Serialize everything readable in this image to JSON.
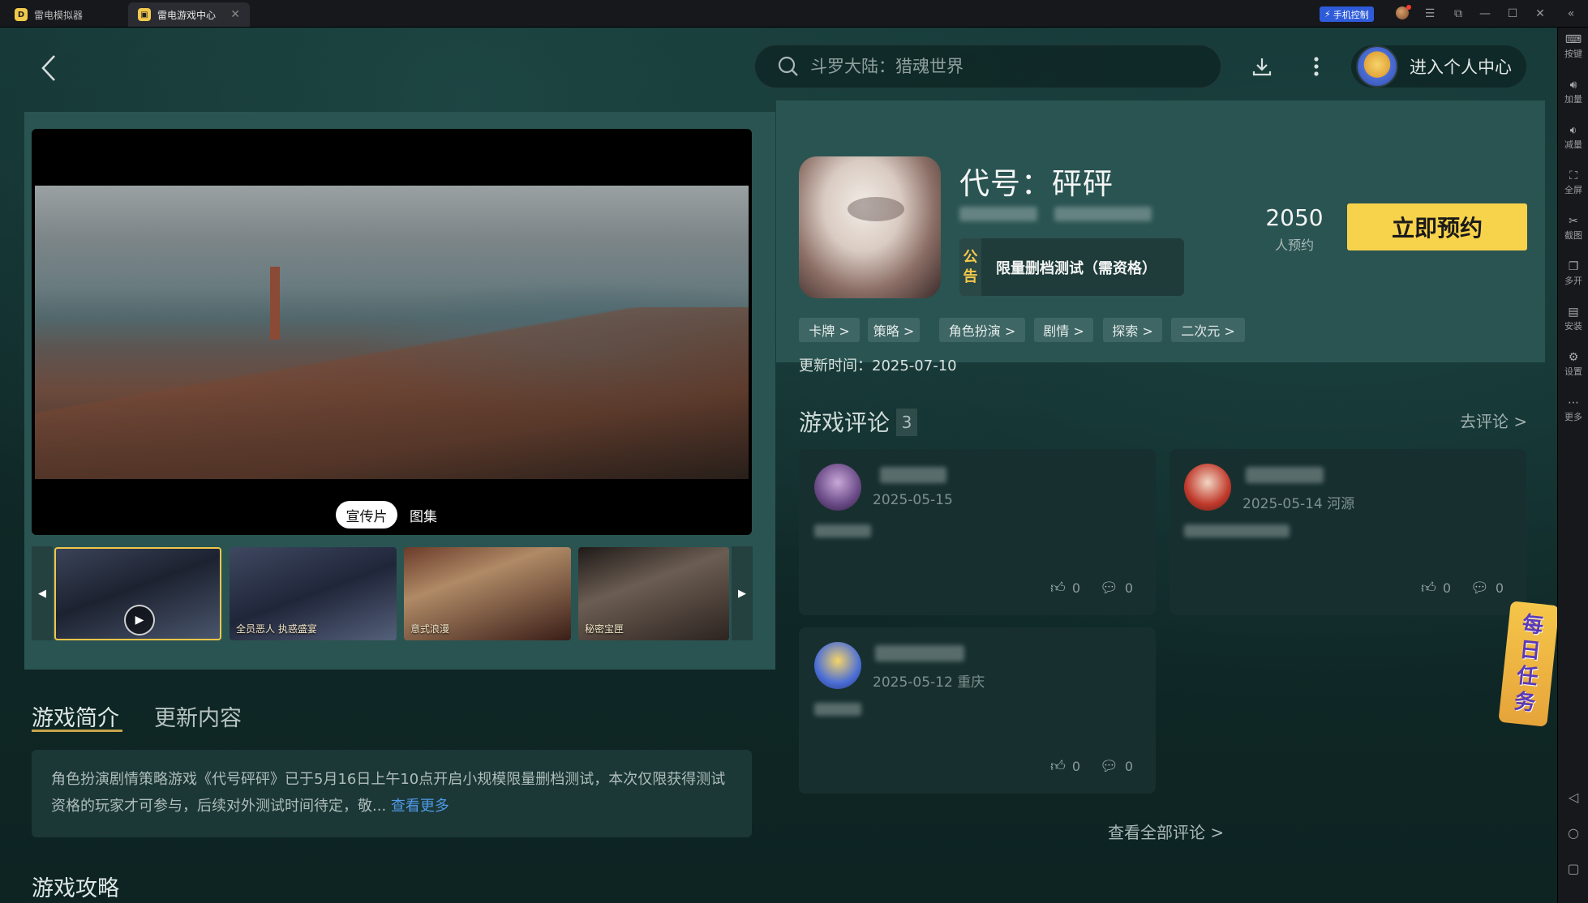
{
  "tabs": [
    {
      "label": "雷电模拟器"
    },
    {
      "label": "雷电游戏中心"
    }
  ],
  "titlebar": {
    "phone_control": "手机控制"
  },
  "search": {
    "placeholder": "斗罗大陆：猎魂世界"
  },
  "header": {
    "user_center": "进入个人中心"
  },
  "media": {
    "tab_video": "宣传片",
    "tab_gallery": "图集"
  },
  "thumbs": [
    {
      "caption": ""
    },
    {
      "caption": "全员恶人 执惑盛宴"
    },
    {
      "caption": "意式浪漫"
    },
    {
      "caption": "秘密宝匣"
    }
  ],
  "game": {
    "title": "代号：砰砰",
    "notice_tag_1": "公",
    "notice_tag_2": "告",
    "notice": "限量删档测试（需资格）",
    "reserve_count": "2050",
    "reserve_label": "人预约",
    "reserve_button": "立即预约",
    "update_time": "更新时间：2025-07-10",
    "tags": [
      "卡牌 >",
      "策略 >",
      "角色扮演 >",
      "剧情 >",
      "探索 >",
      "二次元 >"
    ]
  },
  "intro": {
    "tab_intro": "游戏简介",
    "tab_update": "更新内容",
    "text": "角色扮演剧情策略游戏《代号砰砰》已于5月16日上午10点开启小规模限量删档测试，本次仅限获得测试资格的玩家才可参与，后续对外测试时间待定，敬...",
    "more": "查看更多",
    "guide_title": "游戏攻略"
  },
  "comments": {
    "title": "游戏评论",
    "count": "3",
    "go": "去评论 >",
    "all": "查看全部评论 >",
    "items": [
      {
        "date": "2025-05-15",
        "likes": "0",
        "replies": "0"
      },
      {
        "date": "2025-05-14 河源",
        "likes": "0",
        "replies": "0"
      },
      {
        "date": "2025-05-12 重庆",
        "likes": "0",
        "replies": "0"
      }
    ]
  },
  "daily_task": [
    "每",
    "日",
    "任",
    "务"
  ],
  "rightbar": [
    "按键",
    "加量",
    "减量",
    "全屏",
    "截图",
    "多开",
    "安装",
    "设置",
    "更多"
  ]
}
